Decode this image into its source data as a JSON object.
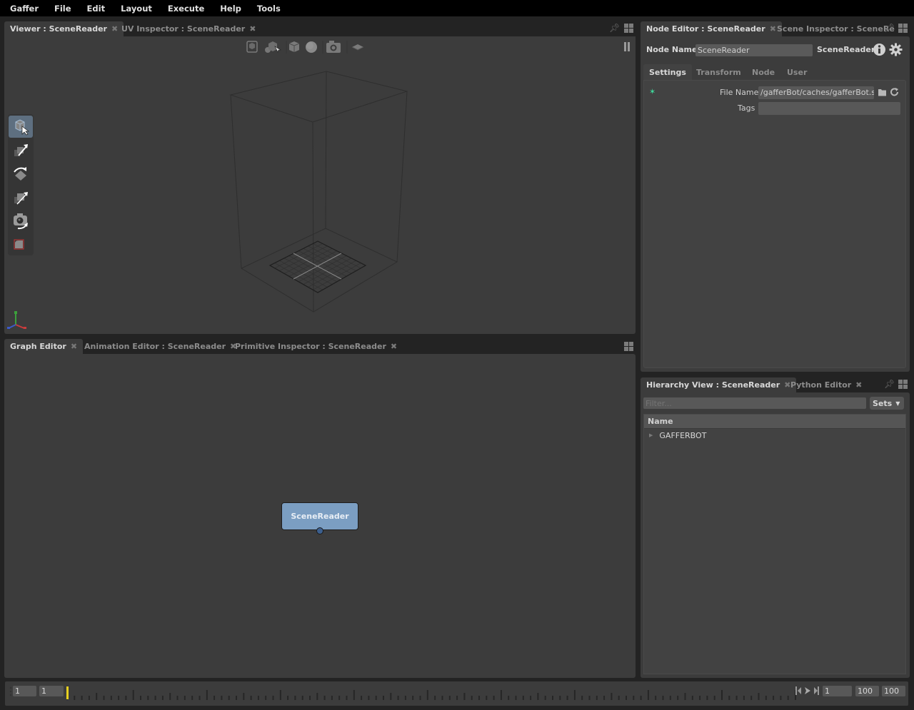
{
  "menubar": [
    "Gaffer",
    "File",
    "Edit",
    "Layout",
    "Execute",
    "Help",
    "Tools"
  ],
  "viewer_panel": {
    "tabs": [
      {
        "label": "Viewer : SceneReader",
        "active": true
      },
      {
        "label": "UV Inspector : SceneReader",
        "active": false
      }
    ],
    "toolbar_icons": [
      "selection-mask-icon",
      "shading-mode-icon",
      "expand-icon",
      "lighting-icon",
      "camera-icon",
      "grid-icon"
    ],
    "pause_icon": "pause-icon",
    "tools": [
      {
        "name": "select-tool",
        "selected": true
      },
      {
        "name": "translate-tool",
        "selected": false
      },
      {
        "name": "rotate-tool",
        "selected": false
      },
      {
        "name": "scale-tool",
        "selected": false
      },
      {
        "name": "camera-tool",
        "selected": false
      },
      {
        "name": "crop-window-tool",
        "selected": false
      }
    ],
    "axis_colors": {
      "x": "#c83c3c",
      "y": "#3ca03c",
      "z": "#3c5ac8"
    }
  },
  "graph_panel": {
    "tabs": [
      {
        "label": "Graph Editor",
        "active": true
      },
      {
        "label": "Animation Editor : SceneReader",
        "active": false
      },
      {
        "label": "Primitive Inspector : SceneReader",
        "active": false
      }
    ],
    "node": {
      "label": "SceneReader",
      "color": "#7b9ec2"
    }
  },
  "node_editor": {
    "tabs": [
      {
        "label": "Node Editor : SceneReader",
        "active": true
      },
      {
        "label": "Scene Inspector : SceneRe",
        "active": false
      }
    ],
    "node_name_label": "Node Name",
    "node_name_value": "SceneReader",
    "node_type": "SceneReader",
    "subtabs": [
      "Settings",
      "Transform",
      "Node",
      "User"
    ],
    "active_subtab": "Settings",
    "plugs": [
      {
        "label": "File Name",
        "value": "/gafferBot/caches/gafferBot.scc"
      },
      {
        "label": "Tags",
        "value": ""
      }
    ]
  },
  "hierarchy_panel": {
    "tabs": [
      {
        "label": "Hierarchy View : SceneReader",
        "active": true
      },
      {
        "label": "Python Editor",
        "active": false
      }
    ],
    "filter_placeholder": "Filter...",
    "sets_label": "Sets",
    "column_header": "Name",
    "items": [
      {
        "label": "GAFFERBOT",
        "expanded": false
      }
    ]
  },
  "timeline": {
    "start_field": "1",
    "current_frame_left": "1",
    "current_frame": "1",
    "end_field": "100",
    "range_end": "100",
    "frame_range": [
      1,
      100
    ],
    "playhead_color": "#e8d020"
  }
}
